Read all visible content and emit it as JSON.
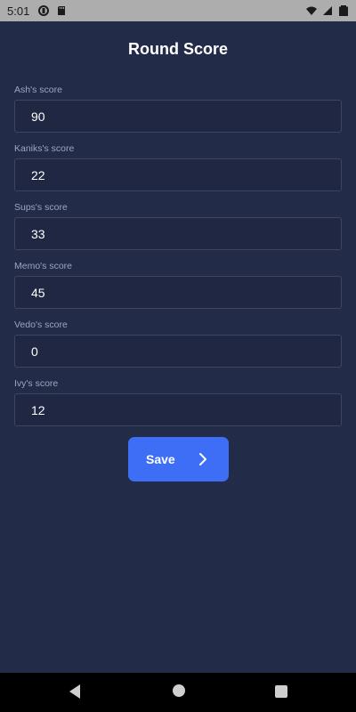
{
  "status_bar": {
    "time": "5:01",
    "icons": [
      "data-saver-icon",
      "sd-card-icon",
      "wifi-icon",
      "signal-icon",
      "battery-icon"
    ]
  },
  "page": {
    "title": "Round Score"
  },
  "fields": [
    {
      "label": "Ash's score",
      "value": "90"
    },
    {
      "label": "Kaniks's score",
      "value": "22"
    },
    {
      "label": "Sups's score",
      "value": "33"
    },
    {
      "label": "Memo's score",
      "value": "45"
    },
    {
      "label": "Vedo's score",
      "value": "0"
    },
    {
      "label": "Ivy's score",
      "value": "12"
    }
  ],
  "actions": {
    "save_label": "Save"
  },
  "colors": {
    "background": "#222c49",
    "accent": "#3d6ef5"
  },
  "nav_bar": {
    "icons": [
      "back-icon",
      "home-icon",
      "recents-icon"
    ]
  }
}
